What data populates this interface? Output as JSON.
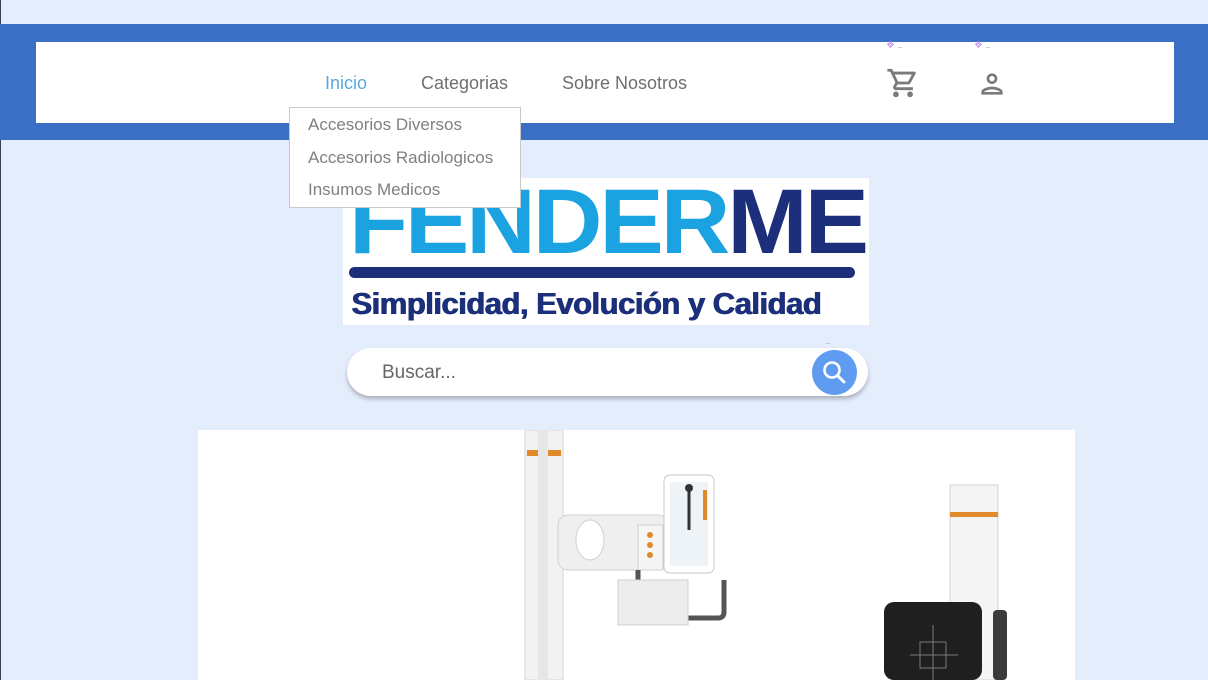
{
  "nav": {
    "links": [
      {
        "label": "Inicio",
        "active": true
      },
      {
        "label": "Categorias",
        "active": false
      },
      {
        "label": "Sobre Nosotros",
        "active": false
      }
    ],
    "icons": {
      "cart": "shopping-cart-icon",
      "user": "user-icon"
    },
    "dropdown": {
      "items": [
        {
          "label": "Accesorios Diversos"
        },
        {
          "label": "Accesorios Radiologicos"
        },
        {
          "label": "Insumos Medicos"
        }
      ]
    }
  },
  "logo": {
    "word_part1": "FENDER",
    "word_part2": "MED",
    "tagline": "Simplicidad, Evolución y Calidad",
    "colors": {
      "light": "#1aa3e0",
      "dark": "#1b2f7a"
    }
  },
  "search": {
    "placeholder": "Buscar...",
    "button_icon": "search-icon"
  },
  "hero": {
    "image": "xray-equipment-image"
  },
  "colors": {
    "background": "#e3edfc",
    "header": "#3b6fc6",
    "accent": "#59a8dc",
    "search_button": "#5f9cf1"
  }
}
